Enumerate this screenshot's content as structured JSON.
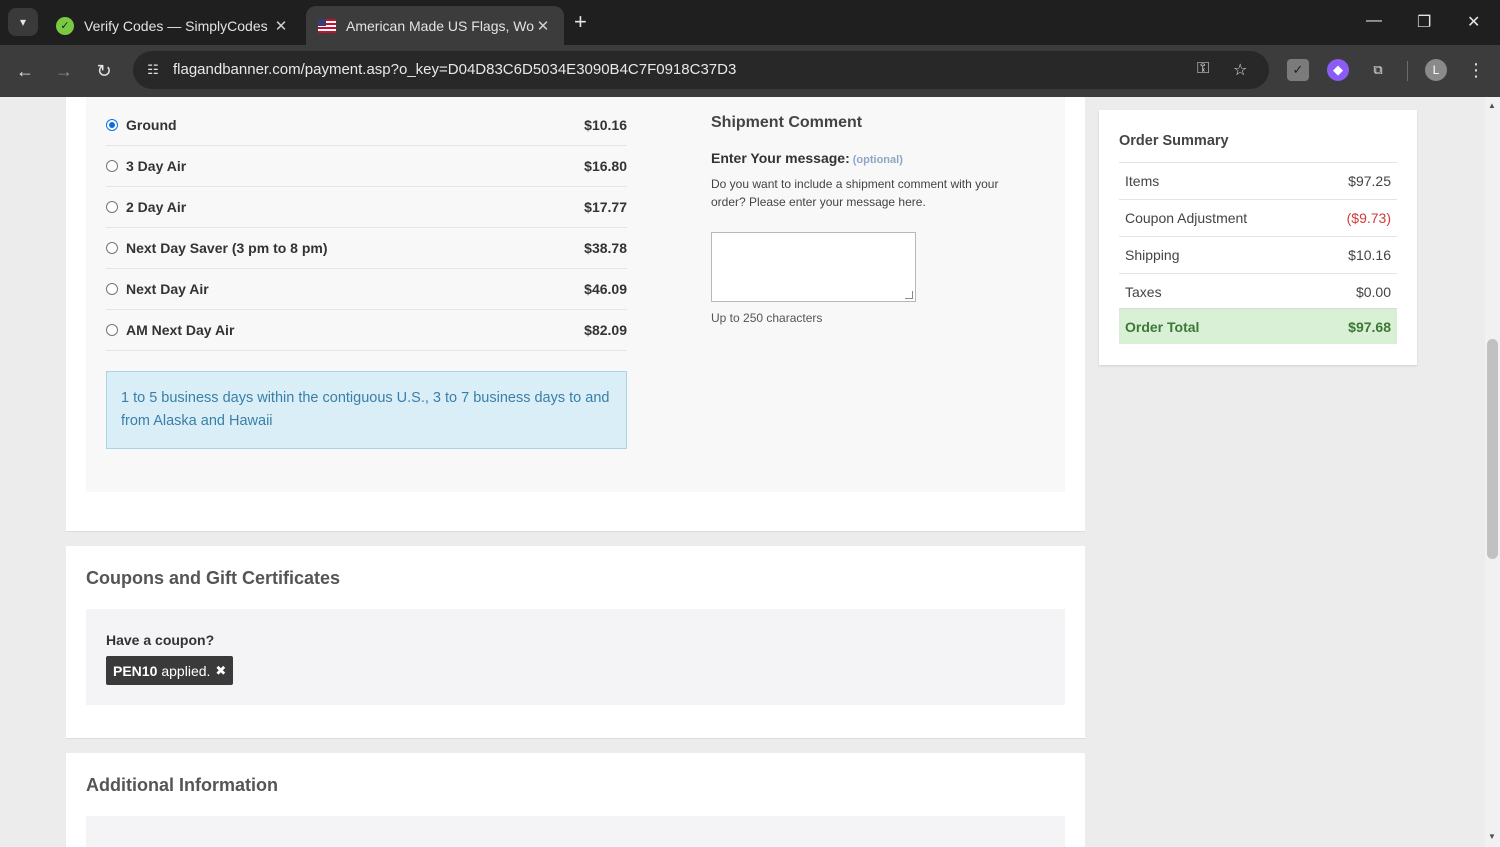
{
  "browser": {
    "tabs": [
      {
        "title": "Verify Codes — SimplyCodes",
        "active": false
      },
      {
        "title": "American Made US Flags, World",
        "active": true
      }
    ],
    "url": "flagandbanner.com/payment.asp?o_key=D04D83C6D5034E3090B4C7F0918C37D3",
    "profile_initial": "L"
  },
  "shipping": {
    "options": [
      {
        "name": "Ground",
        "price": "$10.16",
        "selected": true
      },
      {
        "name": "3 Day Air",
        "price": "$16.80",
        "selected": false
      },
      {
        "name": "2 Day Air",
        "price": "$17.77",
        "selected": false
      },
      {
        "name": "Next Day Saver (3 pm to 8 pm)",
        "price": "$38.78",
        "selected": false
      },
      {
        "name": "Next Day Air",
        "price": "$46.09",
        "selected": false
      },
      {
        "name": "AM Next Day Air",
        "price": "$82.09",
        "selected": false
      }
    ],
    "info": "1 to 5 business days within the contiguous U.S., 3 to 7 business days to and from Alaska and Hawaii"
  },
  "comment": {
    "title": "Shipment Comment",
    "label": "Enter Your message:",
    "optional": "(optional)",
    "description": "Do you want to include a shipment comment with your order? Please enter your message here.",
    "value": "",
    "hint": "Up to 250 characters"
  },
  "coupons": {
    "title": "Coupons and Gift Certificates",
    "question": "Have a coupon?",
    "code": "PEN10",
    "applied_text": "applied."
  },
  "additional": {
    "title": "Additional Information"
  },
  "summary": {
    "title": "Order Summary",
    "rows": [
      {
        "label": "Items",
        "value": "$97.25"
      },
      {
        "label": "Coupon Adjustment",
        "value": "($9.73)"
      },
      {
        "label": "Shipping",
        "value": "$10.16"
      },
      {
        "label": "Taxes",
        "value": "$0.00"
      }
    ],
    "total_label": "Order Total",
    "total_value": "$97.68"
  },
  "colors": {
    "accent": "#0b6fe0",
    "info_bg": "#d9eef7",
    "total_bg": "#d9efd6",
    "negative": "#d23b3b"
  }
}
